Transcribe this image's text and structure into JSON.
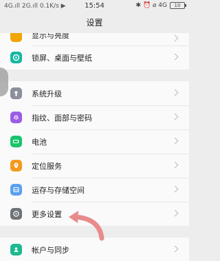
{
  "status_bar": {
    "left": "4G.ıll 2G.ıll 0.1K/s ▶",
    "time": "15:54",
    "right_icons": "✱ ⏰ ⌀ 4G",
    "battery": "10"
  },
  "header": {
    "title": "设置"
  },
  "items": {
    "partial": {
      "label": "显示与亮度"
    },
    "lock": {
      "label": "锁屏、桌面与壁纸"
    },
    "upgrade": {
      "label": "系统升级"
    },
    "fingerprint": {
      "label": "指纹、面部与密码"
    },
    "battery": {
      "label": "电池"
    },
    "location": {
      "label": "定位服务"
    },
    "storage": {
      "label": "运存与存储空间"
    },
    "more": {
      "label": "更多设置"
    },
    "account": {
      "label": "帐户与同步"
    }
  },
  "colors": {
    "lock_icon": "#14b8a0",
    "upgrade_icon": "#8a8f99",
    "fingerprint_icon": "#9b5de5",
    "battery_icon": "#18c46c",
    "location_icon": "#f39a1e",
    "storage_icon": "#5aa0f0",
    "more_icon": "#6f7378",
    "account_icon": "#1db98f",
    "arrow": "#e88b8b"
  }
}
